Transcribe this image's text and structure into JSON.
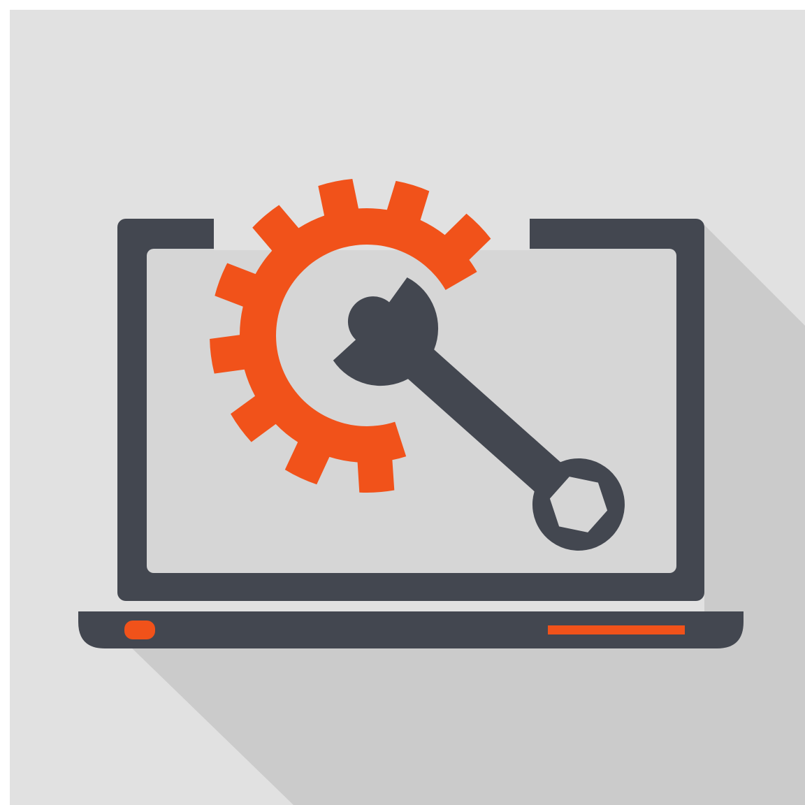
{
  "illustration": {
    "subject": "laptop-maintenance-icon",
    "icons": {
      "laptop": "laptop-icon",
      "gear": "gear-icon",
      "wrench": "wrench-icon",
      "power_light": "power-indicator-icon",
      "status_bar": "status-bar-icon"
    }
  },
  "colors": {
    "background": "#e1e1e1",
    "long_shadow": "#cbcbcb",
    "laptop_body": "#434750",
    "screen": "#d6d6d6",
    "gear": "#f1521a",
    "wrench": "#434750",
    "accent": "#f1521a",
    "frame": "#ffffff"
  }
}
